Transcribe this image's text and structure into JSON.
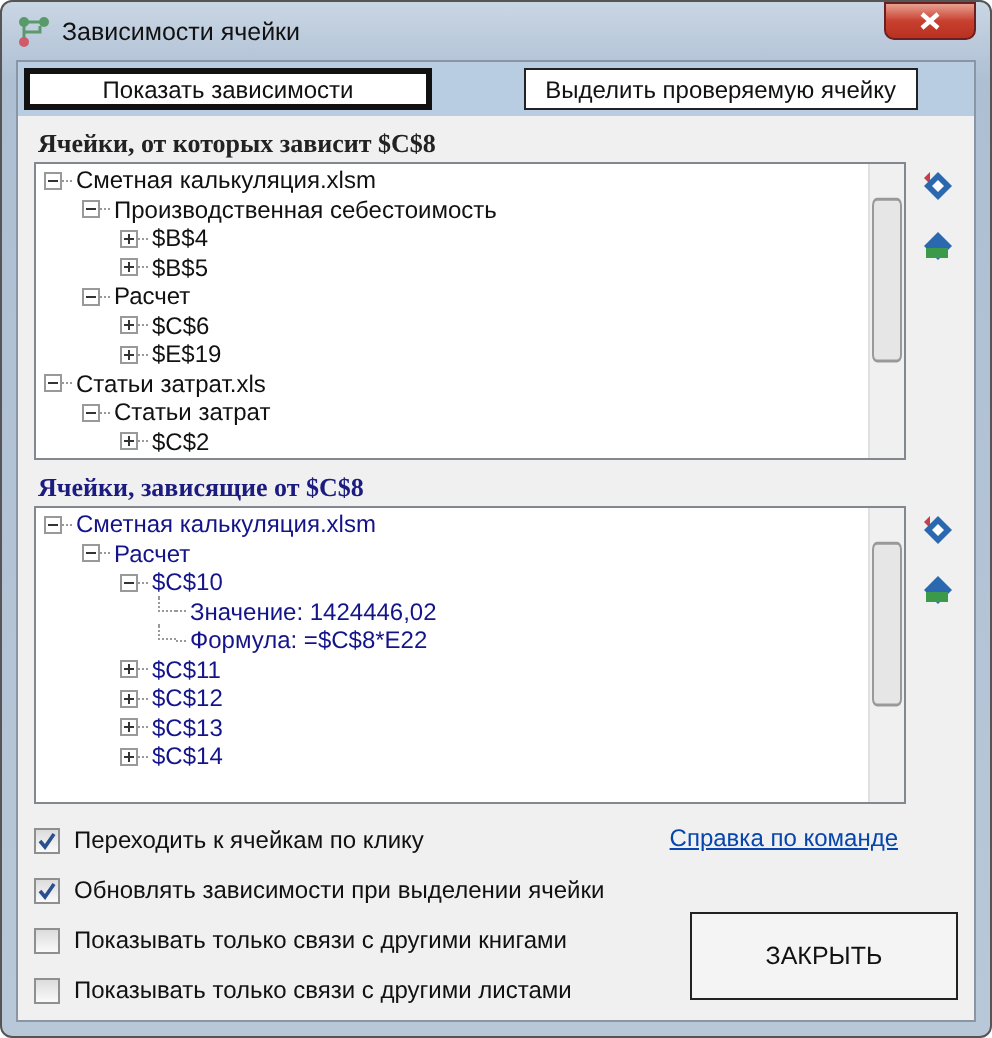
{
  "window": {
    "title": "Зависимости ячейки"
  },
  "toolbar": [
    {
      "label": "Показать зависимости",
      "selected": true
    },
    {
      "label": "Выделить проверяемую ячейку",
      "selected": false
    }
  ],
  "precedents": {
    "title": "Ячейки, от которых зависит $C$8",
    "tree": [
      {
        "label": "Сметная калькуляция.xlsm",
        "expanded": true,
        "children": [
          {
            "label": "Производственная себестоимость",
            "expanded": true,
            "children": [
              {
                "label": "$B$4",
                "expanded": false
              },
              {
                "label": "$B$5",
                "expanded": false
              }
            ]
          },
          {
            "label": "Расчет",
            "expanded": true,
            "children": [
              {
                "label": "$C$6",
                "expanded": false
              },
              {
                "label": "$E$19",
                "expanded": false
              }
            ]
          }
        ]
      },
      {
        "label": "Статьи затрат.xls",
        "expanded": true,
        "children": [
          {
            "label": "Статьи затрат",
            "expanded": true,
            "children": [
              {
                "label": "$C$2",
                "expanded": false
              }
            ]
          }
        ]
      }
    ]
  },
  "dependents": {
    "title": "Ячейки, зависящие от $C$8",
    "tree": [
      {
        "label": "Сметная калькуляция.xlsm",
        "expanded": true,
        "children": [
          {
            "label": "Расчет",
            "expanded": true,
            "children": [
              {
                "label": "$C$10",
                "expanded": true,
                "children": [
                  {
                    "label": "Значение: 1424446,02"
                  },
                  {
                    "label": "Формула: =$C$8*E22"
                  }
                ]
              },
              {
                "label": "$C$11",
                "expanded": false
              },
              {
                "label": "$C$12",
                "expanded": false
              },
              {
                "label": "$C$13",
                "expanded": false
              },
              {
                "label": "$C$14",
                "expanded": false
              }
            ]
          }
        ]
      }
    ]
  },
  "options": [
    {
      "label": "Переходить к ячейкам по клику",
      "checked": true
    },
    {
      "label": "Обновлять зависимости при выделении ячейки",
      "checked": true
    },
    {
      "label": "Показывать только связи с другими книгами",
      "checked": false
    },
    {
      "label": "Показывать только связи с другими листами",
      "checked": false
    }
  ],
  "help_link": "Справка по команде",
  "close_button": "ЗАКРЫТЬ"
}
